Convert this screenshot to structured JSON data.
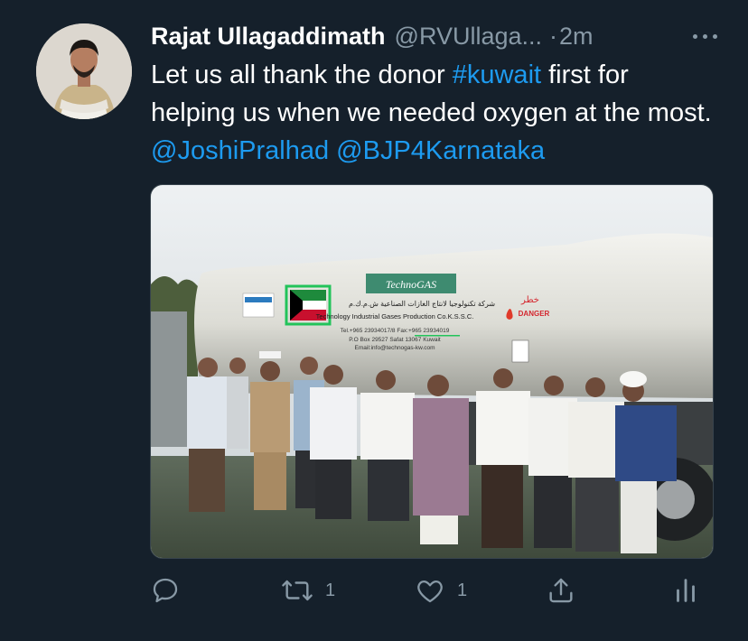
{
  "tweet": {
    "author_name": "Rajat Ullagaddimath",
    "handle": "@RVUllaga...",
    "separator": "·",
    "time": "2m",
    "text_segments": [
      {
        "text": "Let us all thank the donor ",
        "type": "text"
      },
      {
        "text": "#kuwait",
        "type": "hashtag"
      },
      {
        "text": " first for helping us when we needed oxygen at the most. ",
        "type": "text"
      },
      {
        "text": "@JoshiPralhad",
        "type": "mention"
      },
      {
        "text": " ",
        "type": "text"
      },
      {
        "text": "@BJP4Karnataka",
        "type": "mention"
      }
    ],
    "media": {
      "tank_brand": "TechnoGAS",
      "tank_company": "Technology Industrial Gases Production Co.K.S.S.C.",
      "tank_arabic": "شركة تكنولوجيا لانتاج الغازات الصناعية ش.م.ك.م",
      "tank_contact": "Tel.+965 23934017/8  Fax:+965 23934019",
      "tank_address": "P.O Box 29527 Safat 13067 Kuwait",
      "tank_email": "Email:info@technogas-kw.com",
      "danger_arabic": "خطر",
      "danger_label": "DANGER"
    },
    "actions": {
      "reply_count": "",
      "retweet_count": "1",
      "like_count": "1"
    }
  },
  "colors": {
    "background": "#15202b",
    "link": "#1d9bf0",
    "secondary_text": "#8899a6"
  },
  "icons": [
    "reply-icon",
    "retweet-icon",
    "like-icon",
    "share-icon",
    "analytics-icon",
    "more-icon"
  ]
}
